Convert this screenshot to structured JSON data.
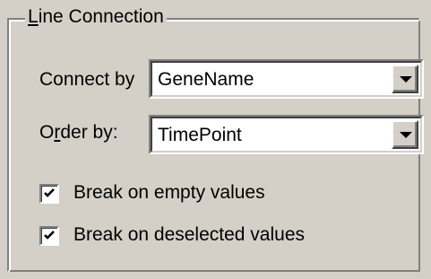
{
  "group": {
    "legend_mnemonic": "L",
    "legend_rest": "ine Connection"
  },
  "connect_by": {
    "label": "Connect by",
    "value": "GeneName"
  },
  "order_by": {
    "label_prefix": "O",
    "label_mnemonic": "r",
    "label_rest": "der by:",
    "value": "TimePoint"
  },
  "checkboxes": [
    {
      "label": "Break on empty values",
      "checked": true
    },
    {
      "label": "Break on deselected values",
      "checked": true
    }
  ],
  "icons": {
    "dropdown": "chevron-down-icon",
    "check": "checkmark-icon"
  },
  "colors": {
    "face": "#d4d0c8",
    "field": "#ffffff",
    "shadow": "#808080",
    "highlight": "#ffffff",
    "text": "#000000"
  }
}
